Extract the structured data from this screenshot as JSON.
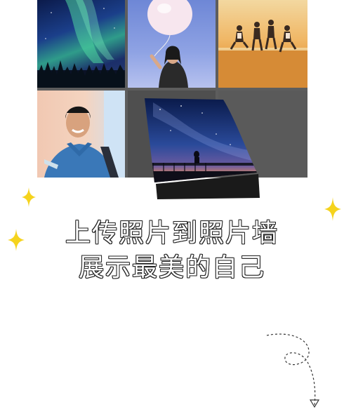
{
  "headline": {
    "line1": "上传照片到照片墙",
    "line2": "展示最美的自己"
  },
  "photo_wall": {
    "tiles": [
      "aurora-photo",
      "balloon-girl-photo",
      "beach-jump-photo",
      "smiling-boy-photo",
      "empty-slot",
      "empty-slot"
    ],
    "featured": "milky-way-bridge-photo"
  },
  "colors": {
    "grid_bg": "#5d5d5d",
    "sparkle": "#f5d31d",
    "text_outline": "#222222"
  },
  "icons": [
    "sparkle-icon",
    "dashed-arrow-icon"
  ]
}
